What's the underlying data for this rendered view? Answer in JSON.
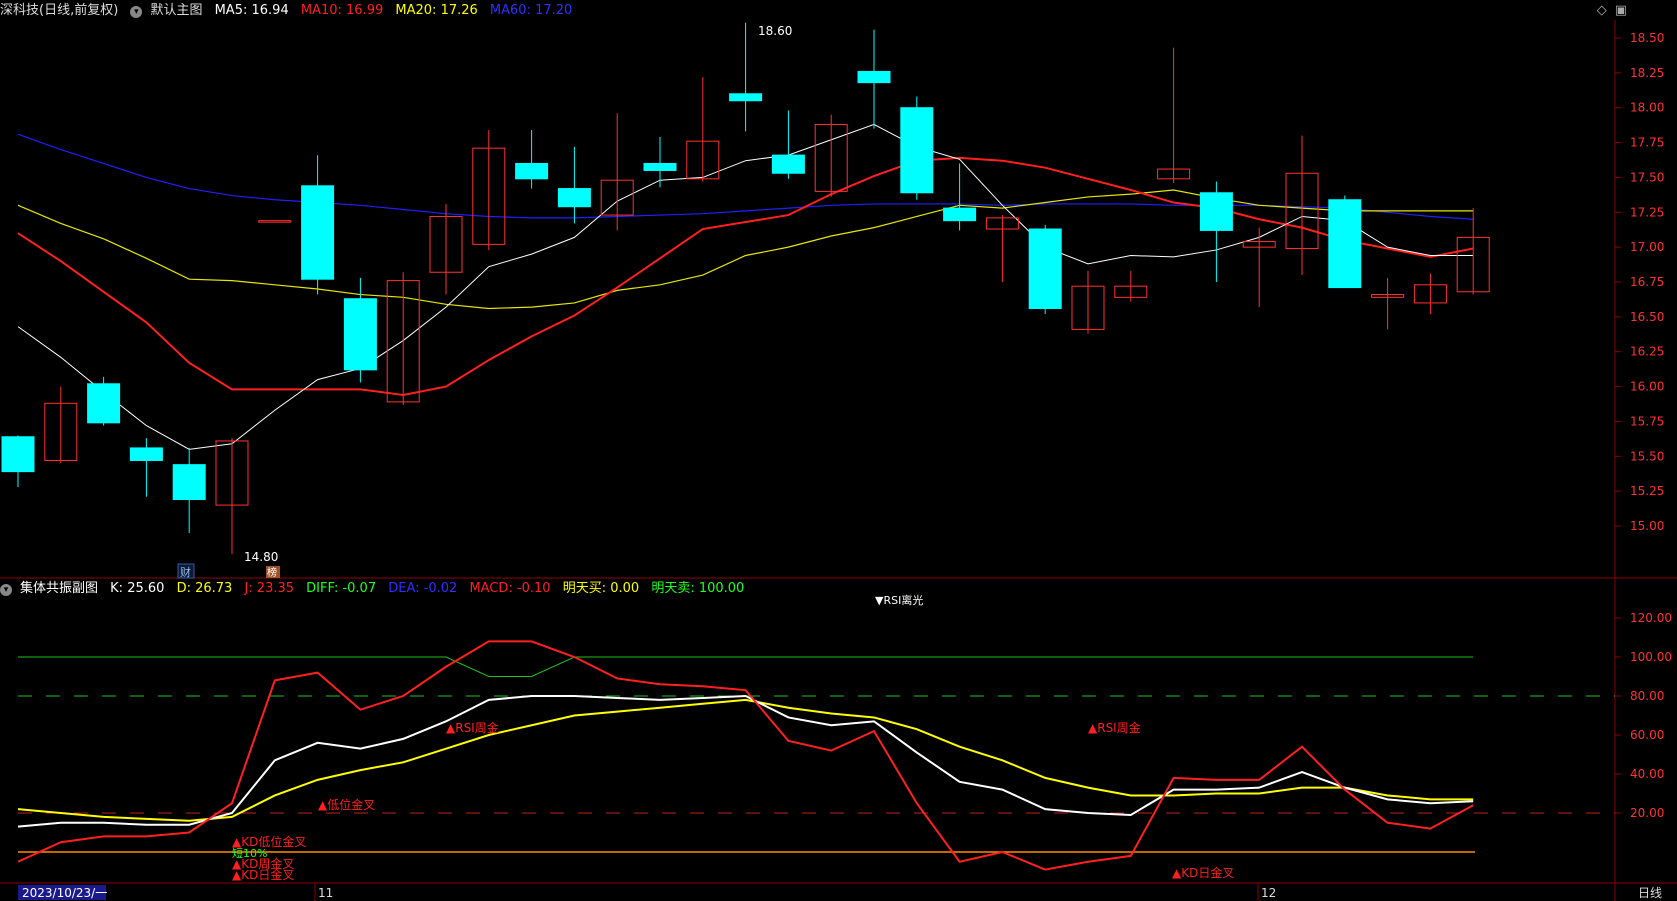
{
  "header": {
    "stock_name": "深科技",
    "mode": "(日线,前复权)",
    "chart_name": "默认主图",
    "ma5": {
      "label": "MA5:",
      "value": "16.94",
      "color": "#ffffff"
    },
    "ma10": {
      "label": "MA10:",
      "value": "16.99",
      "color": "#ff2020"
    },
    "ma20": {
      "label": "MA20:",
      "value": "17.26",
      "color": "#ffff00"
    },
    "ma60": {
      "label": "MA60:",
      "value": "17.20",
      "color": "#2020ff"
    }
  },
  "sub_header": {
    "chart_name": "集体共振副图",
    "k": "K: 25.60",
    "d": "D: 26.73",
    "j": "J: 23.35",
    "diff": "DIFF: -0.07",
    "dea": "DEA: -0.02",
    "macd": "MACD: -0.10",
    "buy": "明天买: 0.00",
    "sell": "明天卖: 100.00"
  },
  "price_axis": [
    "18.50",
    "18.25",
    "18.00",
    "17.75",
    "17.50",
    "17.25",
    "17.00",
    "16.75",
    "16.50",
    "16.25",
    "16.00",
    "15.75",
    "15.50",
    "15.25",
    "15.00"
  ],
  "ind_axis": [
    "120.00",
    "100.00",
    "80.00",
    "60.00",
    "40.00",
    "20.00"
  ],
  "annotations": {
    "high": "18.60",
    "low": "14.80",
    "cai": "财",
    "bang": "榜",
    "rsi_top": "▼RSI离光",
    "rsi_week_gold_1": "▲RSI周金",
    "rsi_week_gold_2": "▲RSI周金",
    "low_gold": "▲低位金叉",
    "kd_low_gold": "▲KD低位金叉",
    "short_pct": "短10%",
    "kd_week_gold": "▲KD周金叉",
    "kd_day_gold_1": "▲KD日金叉",
    "kd_day_gold_2": "▲KD日金叉"
  },
  "date_axis": {
    "current_date": "2023/10/23/一",
    "m11": "11",
    "m12": "12",
    "period": "日线"
  },
  "colors": {
    "up": "#ff3232",
    "down": "#00ffff",
    "grid": "#8b0000",
    "ma5": "#ffffff",
    "ma10": "#ff2020",
    "ma20": "#ffff00",
    "ma60": "#2020ff"
  },
  "candles": [
    {
      "o": 15.64,
      "c": 15.39,
      "h": 15.65,
      "l": 15.28
    },
    {
      "o": 15.47,
      "c": 15.88,
      "h": 16.0,
      "l": 15.45
    },
    {
      "o": 16.02,
      "c": 15.74,
      "h": 16.07,
      "l": 15.72
    },
    {
      "o": 15.56,
      "c": 15.47,
      "h": 15.63,
      "l": 15.21
    },
    {
      "o": 15.44,
      "c": 15.19,
      "h": 15.56,
      "l": 14.95
    },
    {
      "o": 15.15,
      "c": 15.61,
      "h": 15.63,
      "l": 14.8
    },
    {
      "o": 17.19,
      "c": 17.19,
      "h": 17.19,
      "l": 17.19
    },
    {
      "o": 17.44,
      "c": 16.77,
      "h": 17.66,
      "l": 16.66
    },
    {
      "o": 16.63,
      "c": 16.12,
      "h": 16.78,
      "l": 16.03
    },
    {
      "o": 15.89,
      "c": 16.76,
      "h": 16.82,
      "l": 15.87
    },
    {
      "o": 16.82,
      "c": 17.22,
      "h": 17.31,
      "l": 16.66
    },
    {
      "o": 17.02,
      "c": 17.71,
      "h": 17.84,
      "l": 16.98
    },
    {
      "o": 17.6,
      "c": 17.49,
      "h": 17.84,
      "l": 17.42
    },
    {
      "o": 17.42,
      "c": 17.29,
      "h": 17.72,
      "l": 17.17
    },
    {
      "o": 17.23,
      "c": 17.48,
      "h": 17.96,
      "l": 17.12
    },
    {
      "o": 17.6,
      "c": 17.55,
      "h": 17.79,
      "l": 17.43
    },
    {
      "o": 17.49,
      "c": 17.76,
      "h": 18.22,
      "l": 17.47
    },
    {
      "o": 18.1,
      "c": 18.05,
      "h": 18.61,
      "l": 17.83
    },
    {
      "o": 17.66,
      "c": 17.53,
      "h": 17.98,
      "l": 17.49
    },
    {
      "o": 17.4,
      "c": 17.88,
      "h": 17.95,
      "l": 17.36
    },
    {
      "o": 18.26,
      "c": 18.18,
      "h": 18.56,
      "l": 17.85
    },
    {
      "o": 18.0,
      "c": 17.39,
      "h": 18.08,
      "l": 17.34
    },
    {
      "o": 17.28,
      "c": 17.19,
      "h": 17.6,
      "l": 17.12
    },
    {
      "o": 17.13,
      "c": 17.21,
      "h": 17.23,
      "l": 16.75
    },
    {
      "o": 17.13,
      "c": 16.56,
      "h": 17.16,
      "l": 16.52
    },
    {
      "o": 16.41,
      "c": 16.72,
      "h": 16.83,
      "l": 16.38
    },
    {
      "o": 16.64,
      "c": 16.72,
      "h": 16.83,
      "l": 16.61
    },
    {
      "o": 17.49,
      "c": 17.56,
      "h": 18.43,
      "l": 17.46
    },
    {
      "o": 17.39,
      "c": 17.12,
      "h": 17.47,
      "l": 16.75
    },
    {
      "o": 17.0,
      "c": 17.04,
      "h": 17.14,
      "l": 16.57
    },
    {
      "o": 16.99,
      "c": 17.53,
      "h": 17.8,
      "l": 16.8
    },
    {
      "o": 17.34,
      "c": 16.71,
      "h": 17.37,
      "l": 16.71
    },
    {
      "o": 16.64,
      "c": 16.66,
      "h": 16.78,
      "l": 16.41
    },
    {
      "o": 16.6,
      "c": 16.73,
      "h": 16.81,
      "l": 16.52
    },
    {
      "o": 16.68,
      "c": 17.07,
      "h": 17.28,
      "l": 16.66
    }
  ],
  "ma5_series": [
    16.43,
    16.21,
    15.96,
    15.72,
    15.55,
    15.59,
    15.83,
    16.05,
    16.13,
    16.33,
    16.57,
    16.86,
    16.95,
    17.07,
    17.33,
    17.48,
    17.5,
    17.62,
    17.66,
    17.77,
    17.88,
    17.72,
    17.63,
    17.3,
    17.0,
    16.88,
    16.94,
    16.93,
    16.98,
    17.07,
    17.22,
    17.19,
    17.0,
    16.94,
    16.94
  ],
  "ma10_series": [
    17.1,
    16.9,
    16.68,
    16.46,
    16.17,
    15.98,
    15.98,
    15.98,
    15.98,
    15.94,
    16.0,
    16.19,
    16.36,
    16.51,
    16.71,
    16.92,
    17.13,
    17.18,
    17.23,
    17.38,
    17.51,
    17.62,
    17.64,
    17.62,
    17.57,
    17.49,
    17.41,
    17.32,
    17.28,
    17.2,
    17.14,
    17.05,
    16.99,
    16.93,
    16.99
  ],
  "ma20_series": [
    17.3,
    17.17,
    17.06,
    16.92,
    16.77,
    16.76,
    16.73,
    16.7,
    16.66,
    16.64,
    16.59,
    16.56,
    16.57,
    16.6,
    16.69,
    16.73,
    16.8,
    16.94,
    17.0,
    17.08,
    17.14,
    17.22,
    17.3,
    17.28,
    17.32,
    17.36,
    17.38,
    17.41,
    17.35,
    17.3,
    17.28,
    17.26,
    17.26,
    17.26,
    17.26
  ],
  "ma60_series": [
    17.81,
    17.7,
    17.6,
    17.5,
    17.42,
    17.37,
    17.34,
    17.32,
    17.3,
    17.27,
    17.24,
    17.22,
    17.21,
    17.21,
    17.22,
    17.23,
    17.24,
    17.26,
    17.28,
    17.3,
    17.31,
    17.31,
    17.31,
    17.3,
    17.31,
    17.31,
    17.31,
    17.3,
    17.3,
    17.3,
    17.29,
    17.28,
    17.25,
    17.22,
    17.2
  ],
  "k_series": [
    13,
    15,
    15,
    14,
    14,
    20,
    47,
    56,
    53,
    58,
    67,
    78,
    80,
    80,
    79,
    78,
    79,
    80,
    69,
    65,
    67,
    51,
    36,
    32,
    22,
    20,
    19,
    32,
    32,
    33,
    41,
    33,
    27,
    25,
    26
  ],
  "d_series": [
    22,
    20,
    18,
    17,
    16,
    18,
    29,
    37,
    42,
    46,
    53,
    60,
    65,
    70,
    72,
    74,
    76,
    78,
    74,
    71,
    69,
    63,
    54,
    47,
    38,
    33,
    29,
    29,
    30,
    30,
    33,
    33,
    29,
    27,
    27
  ],
  "j_series": [
    -5,
    5,
    8,
    8,
    10,
    25,
    88,
    92,
    73,
    80,
    95,
    108,
    108,
    100,
    89,
    86,
    85,
    83,
    57,
    52,
    62,
    25,
    -5,
    0,
    -9,
    -5,
    -2,
    38,
    37,
    37,
    54,
    32,
    15,
    12,
    24
  ],
  "rsi_green_series": [
    100,
    100,
    100,
    100,
    100,
    100,
    100,
    100,
    100,
    100,
    100,
    90,
    90,
    100,
    100,
    100,
    100,
    100,
    100,
    100,
    100,
    100,
    100,
    100,
    100,
    100,
    100,
    100,
    100,
    100,
    100,
    100,
    100,
    100,
    100
  ]
}
